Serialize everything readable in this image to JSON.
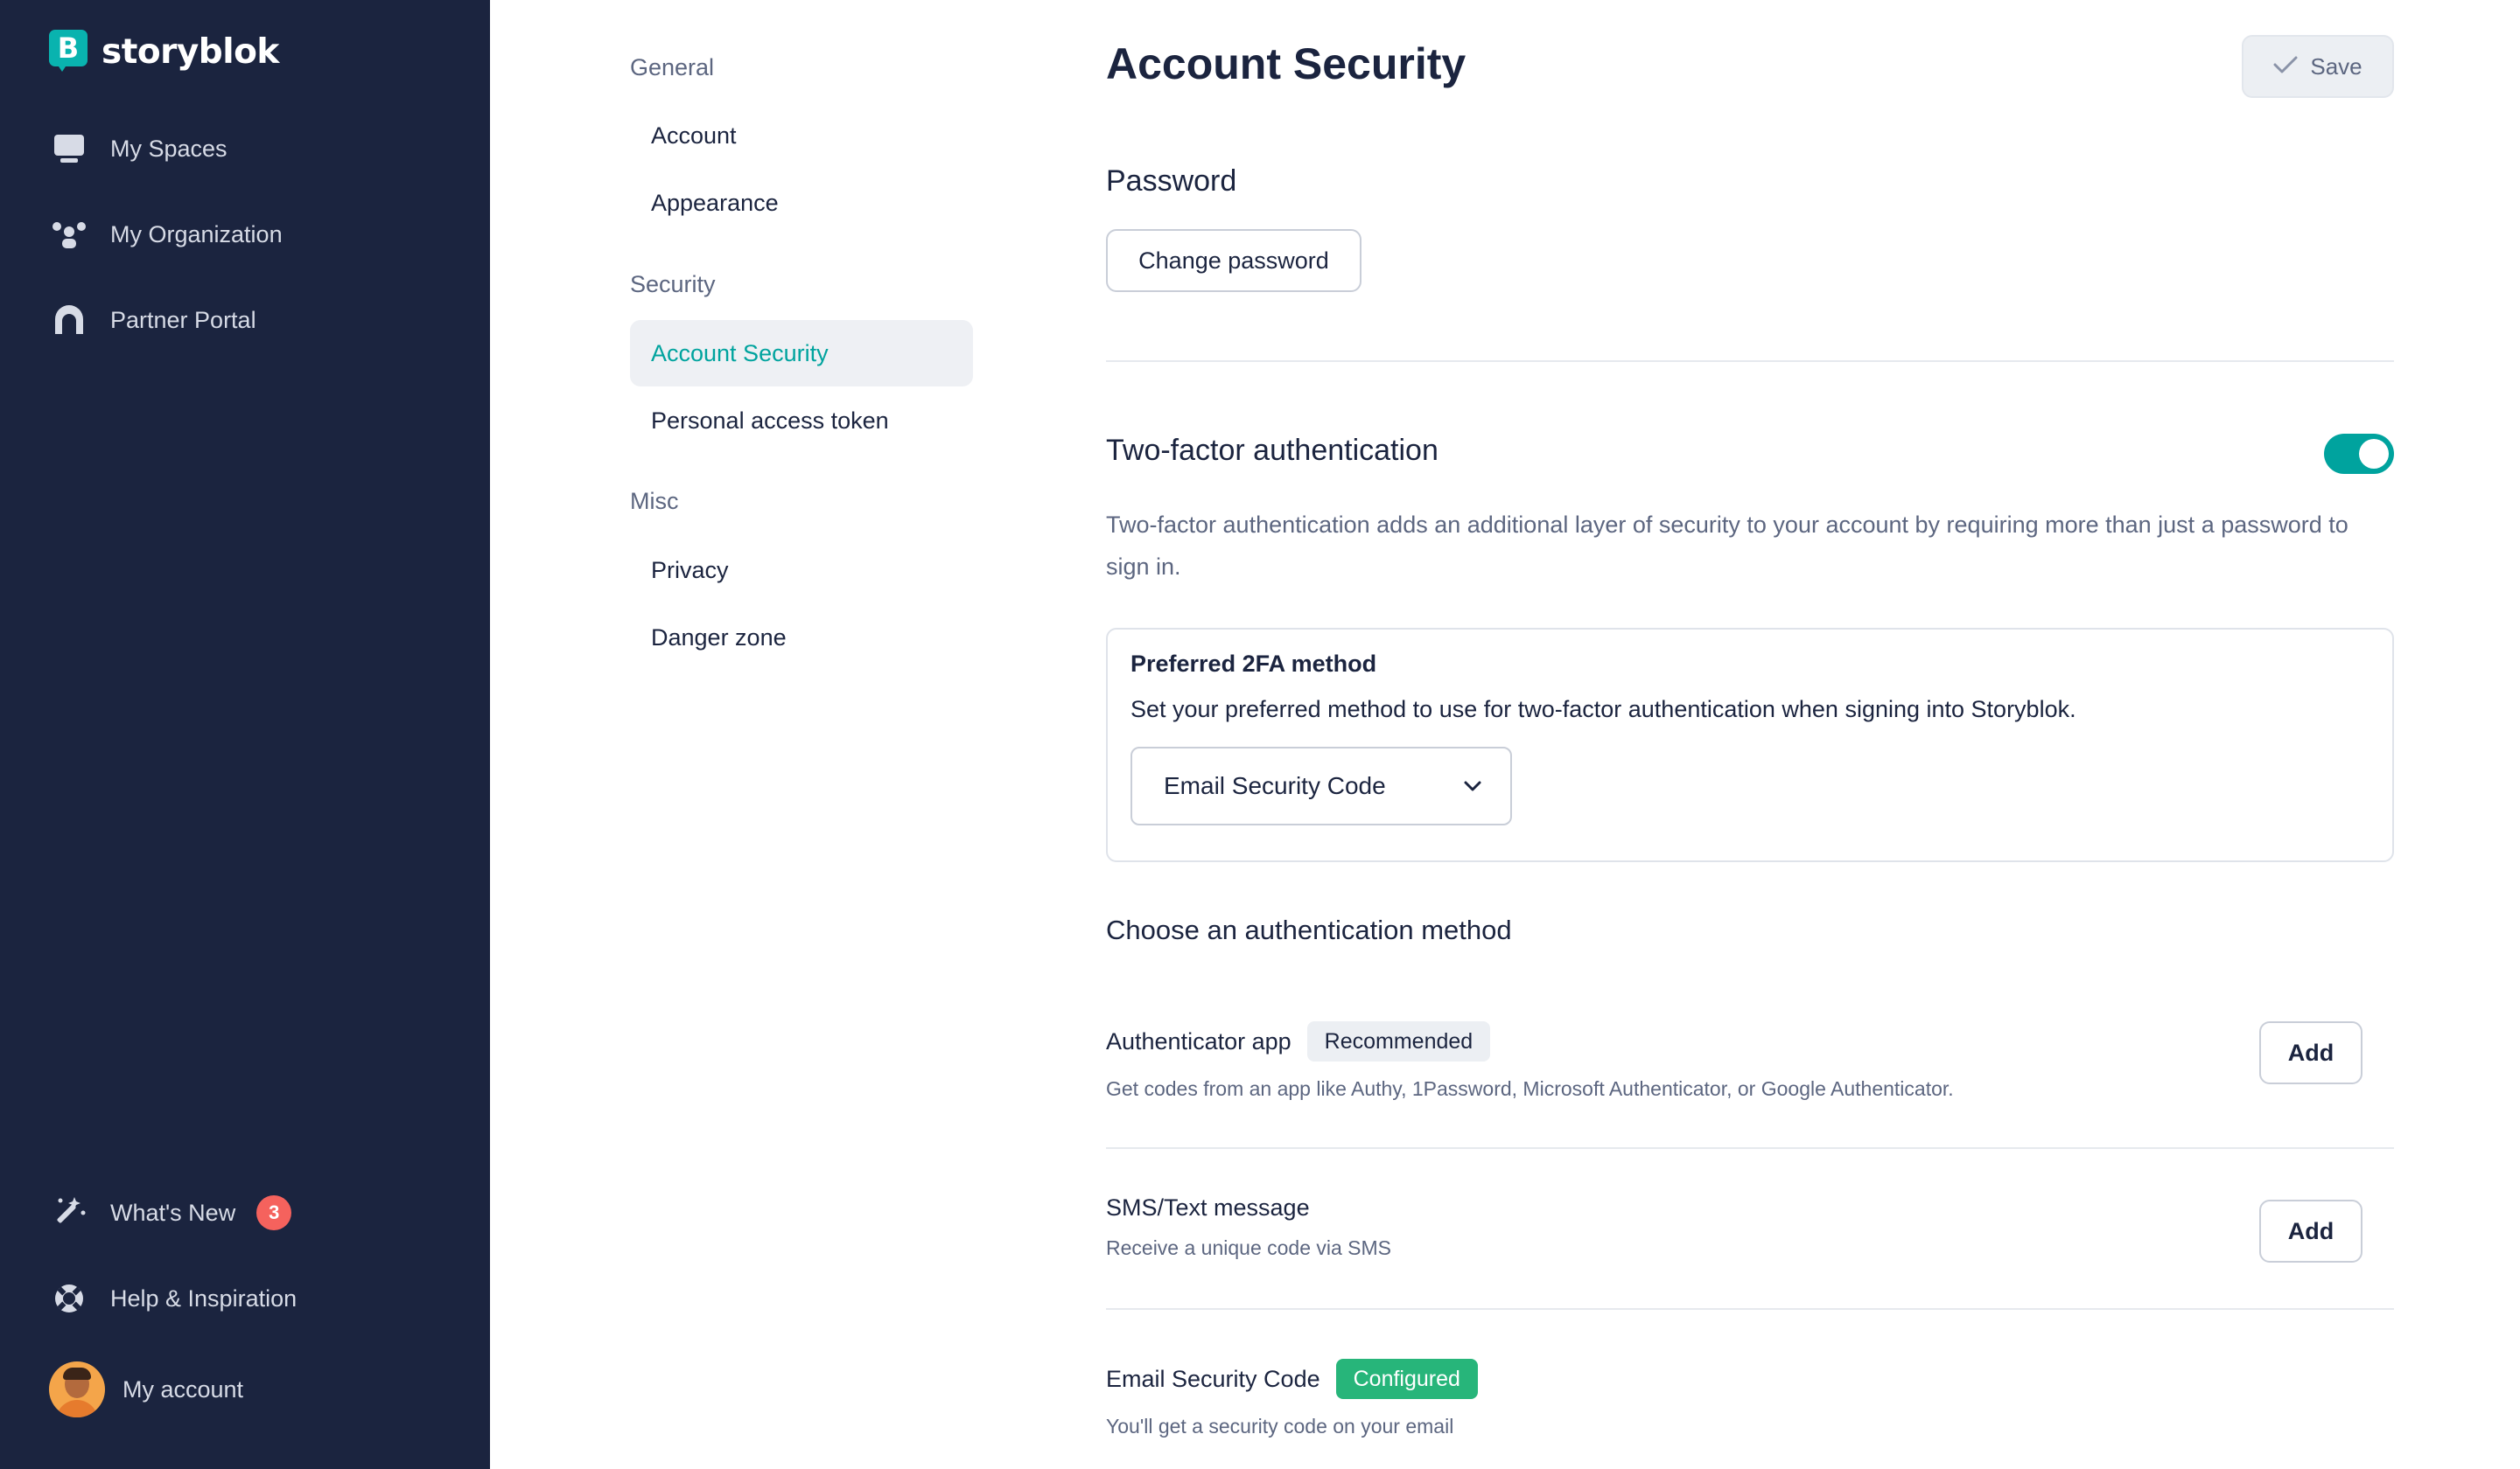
{
  "app": {
    "logo_text": "storyblok"
  },
  "sidebar": {
    "items": [
      {
        "label": "My Spaces"
      },
      {
        "label": "My Organization"
      },
      {
        "label": "Partner Portal"
      }
    ],
    "bottom": {
      "whats_new": {
        "label": "What's New",
        "count": "3"
      },
      "help": {
        "label": "Help & Inspiration"
      },
      "account": {
        "label": "My account"
      }
    }
  },
  "subnav": {
    "groups": [
      {
        "title": "General",
        "items": [
          "Account",
          "Appearance"
        ]
      },
      {
        "title": "Security",
        "items": [
          "Account Security",
          "Personal access token"
        ]
      },
      {
        "title": "Misc",
        "items": [
          "Privacy",
          "Danger zone"
        ]
      }
    ],
    "active": "Account Security"
  },
  "main": {
    "title": "Account Security",
    "save_label": "Save",
    "password": {
      "title": "Password",
      "button": "Change password"
    },
    "two_factor": {
      "title": "Two-factor authentication",
      "enabled": true,
      "description": "Two-factor authentication adds an additional layer of security to your account by requiring more than just a password to sign in.",
      "preferred": {
        "title": "Preferred 2FA method",
        "text": "Set your preferred method to use for two-factor authentication when signing into Storyblok.",
        "selected": "Email Security Code"
      }
    },
    "methods_title": "Choose an authentication method",
    "methods": [
      {
        "name": "Authenticator app",
        "tag": "Recommended",
        "desc": "Get codes from an app like Authy, 1Password, Microsoft Authenticator, or Google Authenticator.",
        "action": "Add"
      },
      {
        "name": "SMS/Text message",
        "desc": "Receive a unique code via SMS",
        "action": "Add"
      },
      {
        "name": "Email Security Code",
        "tag": "Configured",
        "desc": "You'll get a security code on your email"
      }
    ]
  },
  "colors": {
    "sidebar_bg": "#1b243f",
    "accent": "#00a39e",
    "badge_red": "#f5625d",
    "configured_green": "#27b57a"
  },
  "icons": {
    "logo": "storyblok-logo-icon",
    "my_spaces": "monitor-icon",
    "my_organization": "people-group-icon",
    "partner_portal": "arch-icon",
    "whats_new": "magic-wand-icon",
    "help": "lifebuoy-icon",
    "save": "check-icon",
    "select": "chevron-down-icon"
  }
}
